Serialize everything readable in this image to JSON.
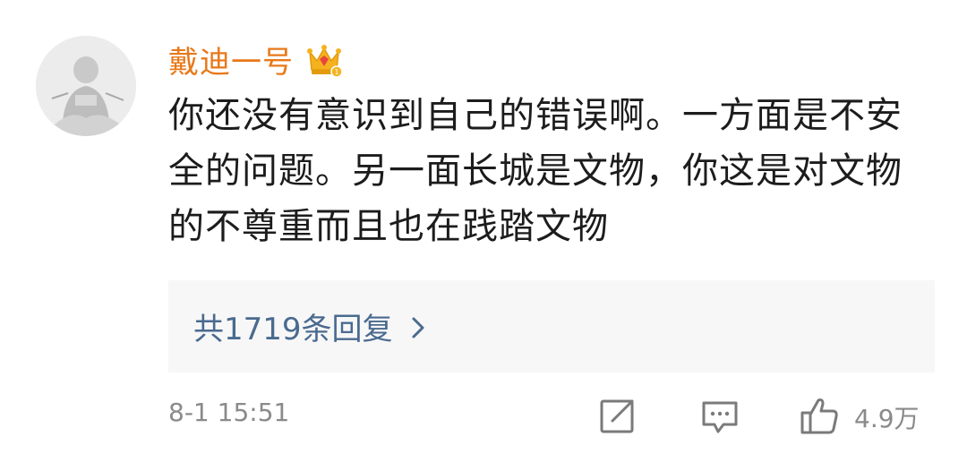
{
  "comment": {
    "username": "戴迪一号",
    "badge_icon": "crown-badge-icon",
    "text": "你还没有意识到自己的错误啊。一方面是不安全的问题。另一面长城是文物，你这是对文物的不尊重而且也在践踏文物",
    "replies_label": "共1719条回复",
    "replies_icon": "chevron-right-icon",
    "timestamp": "8-1 15:51",
    "like_count": "4.9万"
  },
  "colors": {
    "username": "#e8791a",
    "replies_link": "#4a6a8f",
    "meta_text": "#8a8a8a",
    "body_text": "#1c1c1c",
    "replies_bg": "#f7f7f7",
    "icon_stroke": "#7a7a7a"
  },
  "icons": {
    "share": "share-edit-icon",
    "comment": "comment-bubble-icon",
    "like": "thumbs-up-icon"
  }
}
